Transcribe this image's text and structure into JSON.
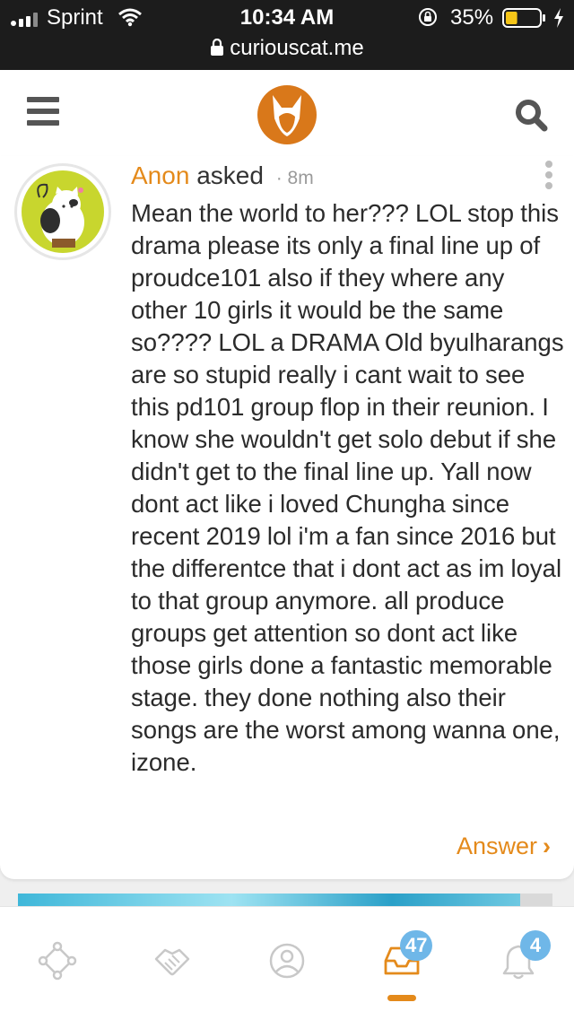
{
  "status_bar": {
    "carrier": "Sprint",
    "time": "10:34 AM",
    "battery_percent": "35%",
    "battery_level": 0.35,
    "url": "curiouscat.me"
  },
  "header": {
    "icons": [
      "menu-icon",
      "curiouscat-logo",
      "search-icon"
    ]
  },
  "post": {
    "asker_name": "Anon",
    "asker_verb": "asked",
    "separator": "·",
    "time_ago": "8m",
    "question": "Mean the world to her??? LOL stop this drama please its only a final line up of proudce101 also if they where any other 10 girls it would be the same so???? LOL a DRAMA Old byulharangs are so stupid really i cant wait to see this pd101 group flop in their reunion. I know she wouldn't get solo debut if she didn't get to the final line up. Yall now dont act like i loved Chungha since recent 2019 lol i'm a fan since 2016 but the differentce that i dont act as im loyal to that group anymore. all produce groups get attention so dont act like those girls done a fantastic memorable stage. they done nothing also their songs are the worst among wanna one, izone.",
    "answer_label": "Answer",
    "answer_chevron": "›"
  },
  "bottom_nav": {
    "items": [
      {
        "icon": "discover-icon"
      },
      {
        "icon": "handshake-icon"
      },
      {
        "icon": "profile-icon"
      },
      {
        "icon": "inbox-icon",
        "badge": "47",
        "active": true
      },
      {
        "icon": "notifications-bell-icon",
        "badge": "4"
      }
    ]
  },
  "colors": {
    "accent": "#e48a1b",
    "badge": "#6fb7e8",
    "status_bar_bg": "#1c1c1c"
  }
}
